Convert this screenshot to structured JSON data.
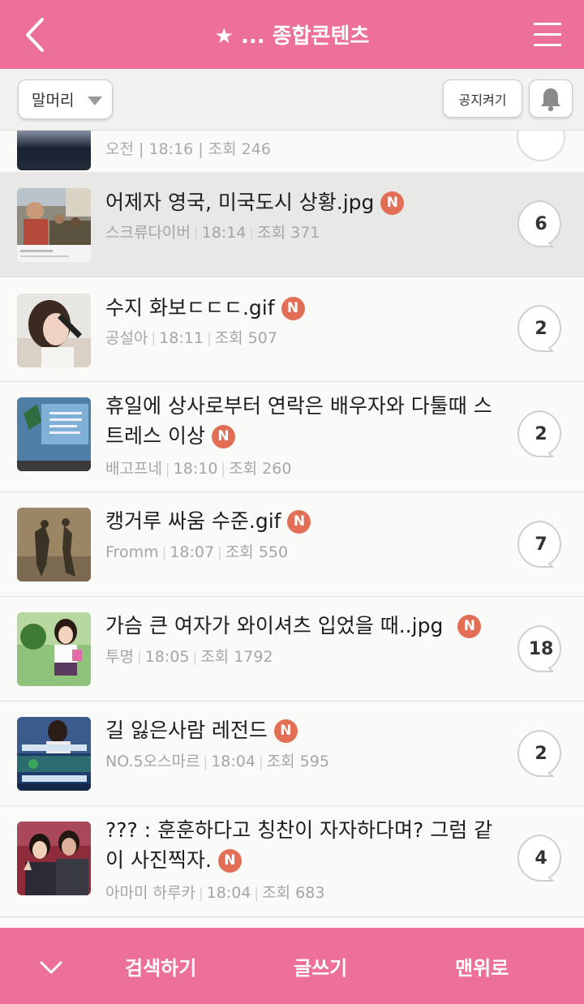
{
  "header": {
    "title": "★ ... 종합콘텐츠"
  },
  "toolbar": {
    "head_select": "말머리",
    "notice_label": "공지켜기"
  },
  "partial_row": {
    "meta": "오전 | 18:16 | 조회 246"
  },
  "badge_letter": "N",
  "posts": [
    {
      "title": "어제자 영국, 미국도시 상황.jpg",
      "author": "스크류다이버",
      "time": "18:14",
      "views": "조회 371",
      "comments": "6"
    },
    {
      "title": "수지 화보ㄷㄷㄷ.gif",
      "author": "공설아",
      "time": "18:11",
      "views": "조회 507",
      "comments": "2"
    },
    {
      "title": "휴일에 상사로부터 연락은 배우자와 다툴때 스트레스 이상",
      "author": "배고프네",
      "time": "18:10",
      "views": "조회 260",
      "comments": "2"
    },
    {
      "title": "캥거루 싸움 수준.gif",
      "author": "Fromm",
      "time": "18:07",
      "views": "조회 550",
      "comments": "7"
    },
    {
      "title": "가슴 큰 여자가 와이셔츠 입었을 때..jpg",
      "author": "투명",
      "time": "18:05",
      "views": "조회 1792",
      "comments": "18"
    },
    {
      "title": "길 잃은사람 레전드",
      "author": "NO.5오스마르",
      "time": "18:04",
      "views": "조회 595",
      "comments": "2"
    },
    {
      "title": "??? : 훈훈하다고 칭찬이 자자하다며? 그럼 같이 사진찍자.",
      "author": "아마미 하루카",
      "time": "18:04",
      "views": "조회 683",
      "comments": "4"
    }
  ],
  "bottom": {
    "search_label": "검색하기",
    "write_label": "글쓰기",
    "top_label": "맨위로"
  },
  "colors": {
    "brand": "#ed7098",
    "new_badge": "#e26f55"
  }
}
